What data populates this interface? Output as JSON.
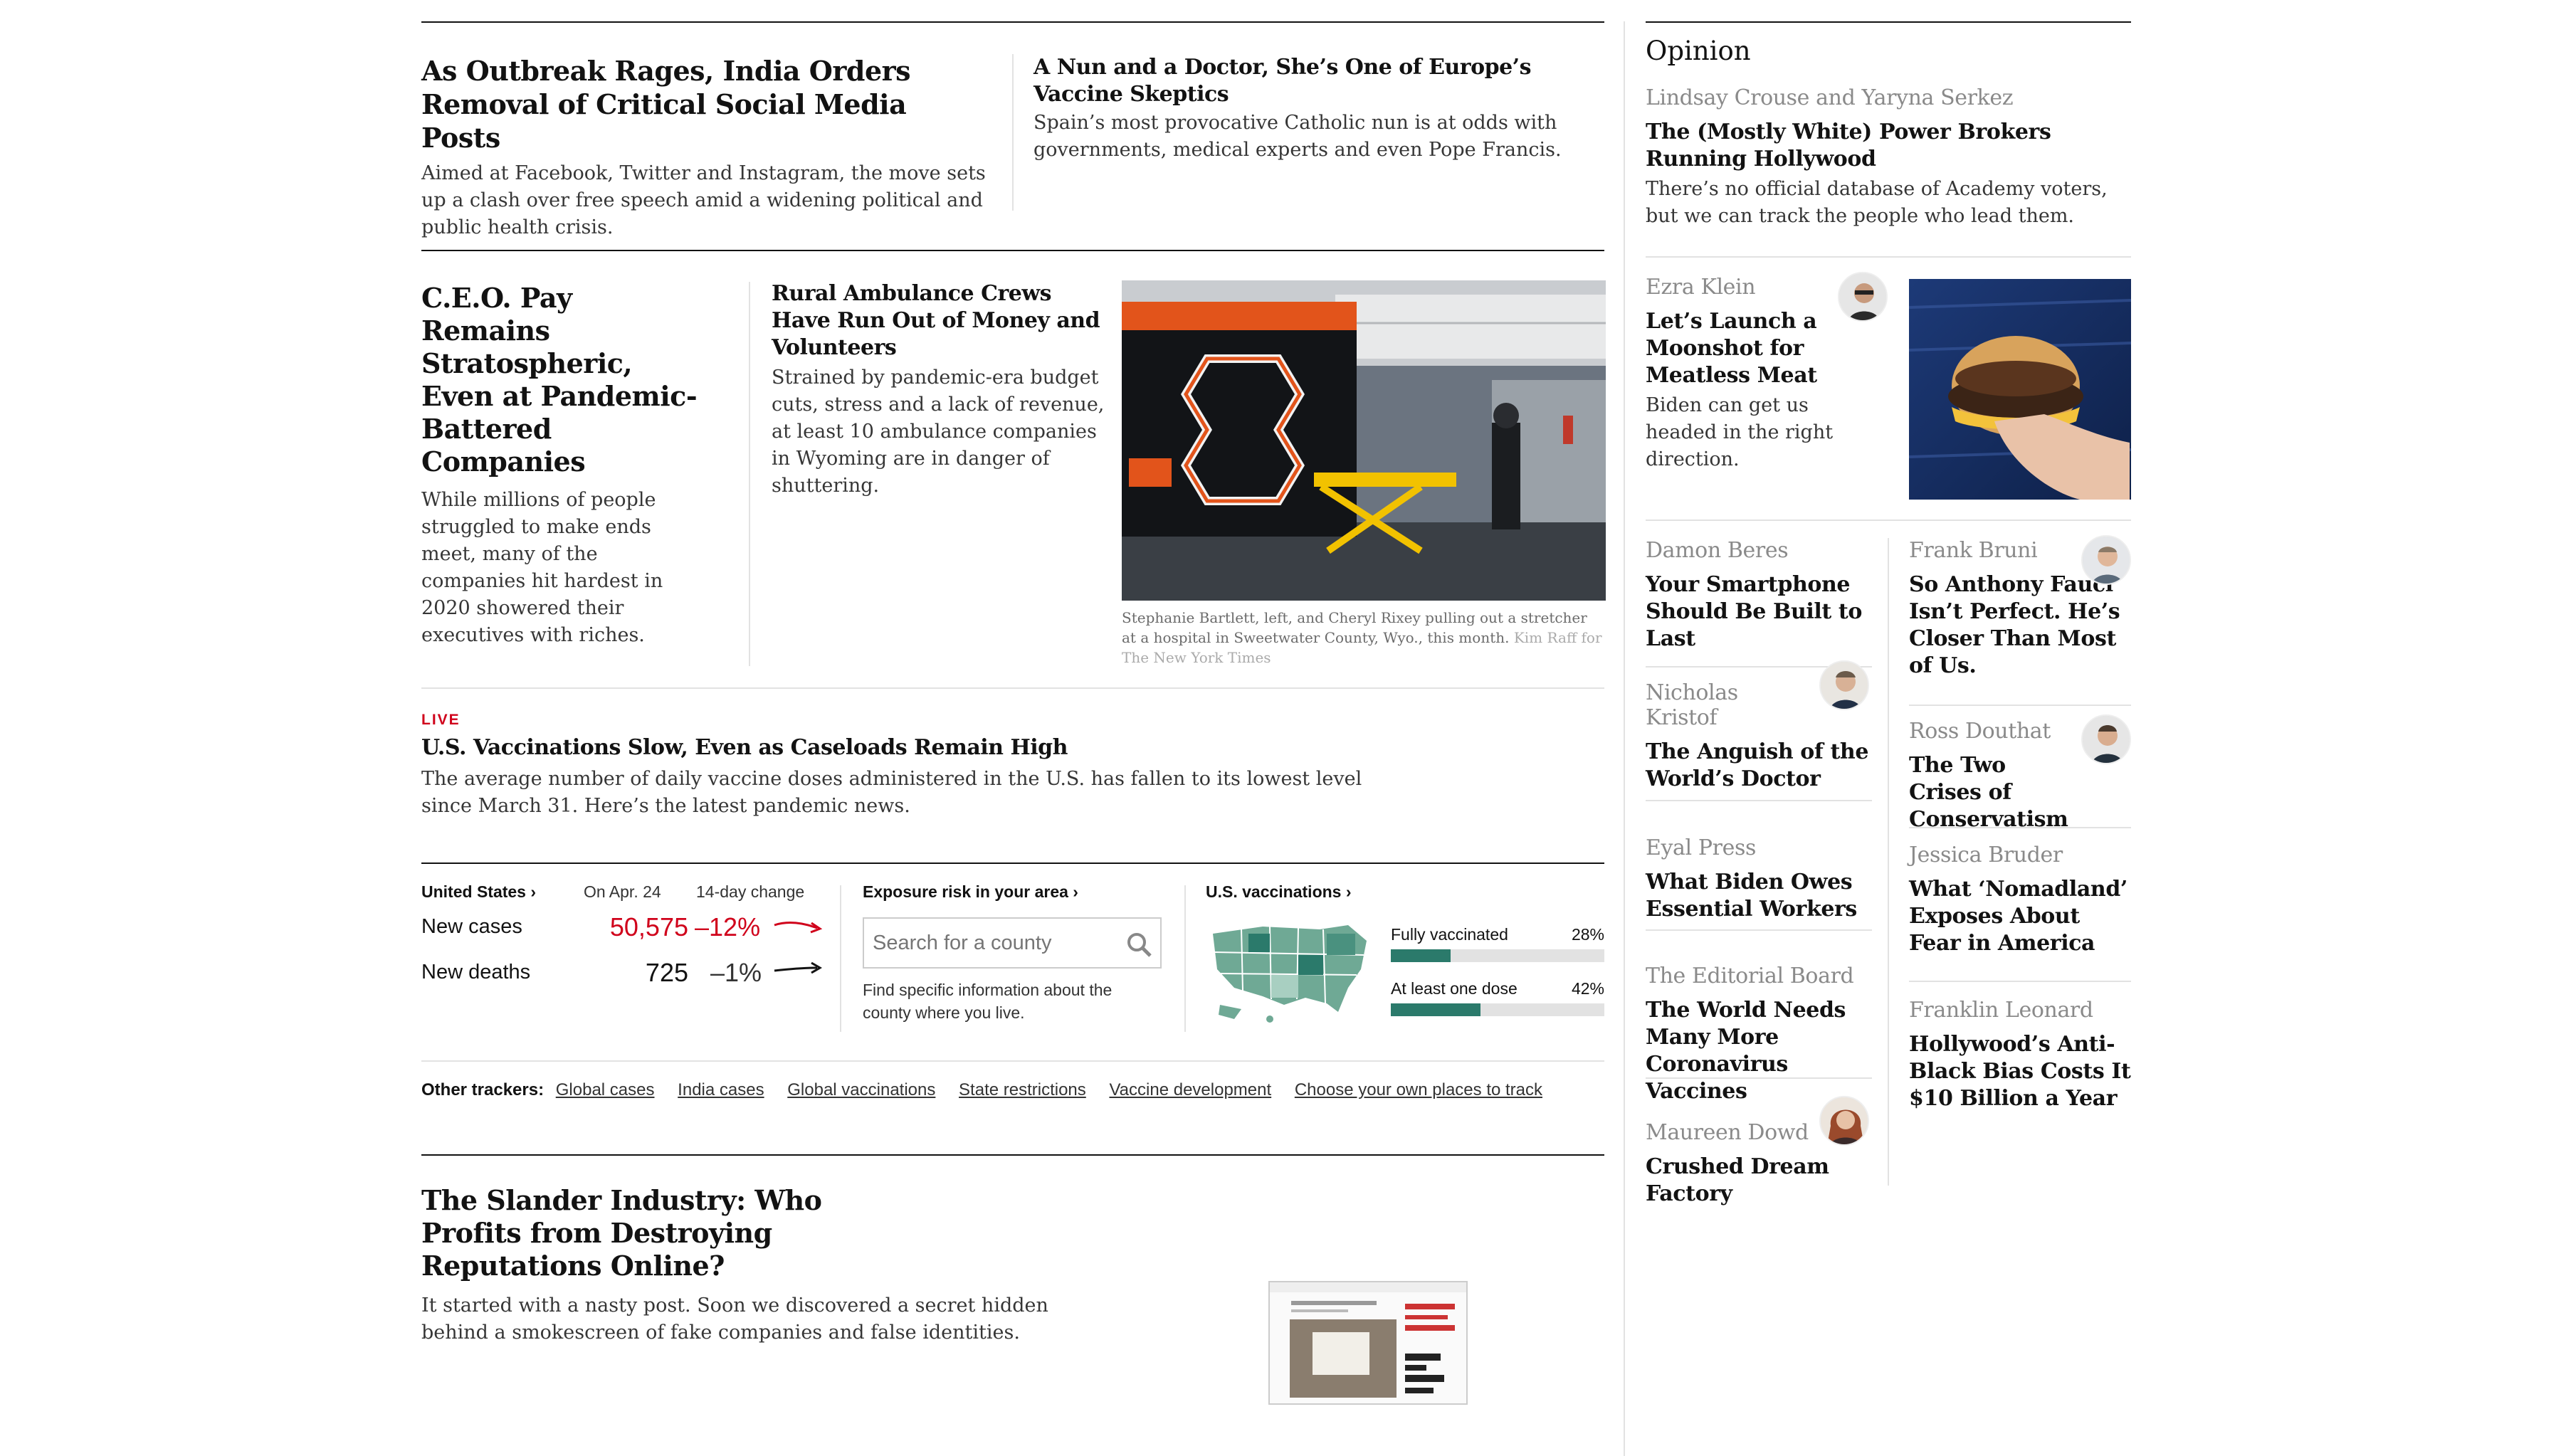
{
  "top": {
    "story1": {
      "headline": "As Outbreak Rages, India Orders Removal of Critical Social Media Posts",
      "summary": "Aimed at Facebook, Twitter and Instagram, the move sets up a clash over free speech amid a widening political and public health crisis."
    },
    "story2": {
      "headline": "A Nun and a Doctor, She’s One of Europe’s Vaccine Skeptics",
      "summary": "Spain’s most provocative Catholic nun is at odds with governments, medical experts and even Pope Francis."
    }
  },
  "mid": {
    "story3": {
      "headline": "C.E.O. Pay Remains Stratospheric, Even at Pandemic-Battered Companies",
      "summary": "While millions of people struggled to make ends meet, many of the companies hit hardest in 2020 showered their executives with riches."
    },
    "story4": {
      "headline": "Rural Ambulance Crews Have Run Out of Money and Volunteers",
      "summary": "Strained by pandemic-era budget cuts, stress and a lack of revenue, at least 10 ambulance companies in Wyoming are in danger of shuttering."
    },
    "photo": {
      "caption": "Stephanie Bartlett, left, and Cheryl Rixey pulling out a stretcher at a hospital in Sweetwater County, Wyo., this month.",
      "credit": "Kim Raff for The New York Times"
    }
  },
  "live": {
    "kicker": "LIVE",
    "headline": "U.S. Vaccinations Slow, Even as Caseloads Remain High",
    "summary": "The average number of daily vaccine doses administered in the U.S. has fallen to its lowest level since March 31. Here’s the latest pandemic news."
  },
  "tracker": {
    "us_label": "United States ›",
    "date_label": "On Apr. 24",
    "change_label": "14-day change",
    "cases_label": "New cases",
    "cases_value": "50,575",
    "cases_change": "–12%",
    "deaths_label": "New deaths",
    "deaths_value": "725",
    "deaths_change": "–1%",
    "exposure_label": "Exposure risk in your area ›",
    "search_placeholder": "Search for a county",
    "exposure_note": "Find specific information about the county where you live.",
    "vacc_label": "U.S. vaccinations ›",
    "fully_label": "Fully vaccinated",
    "fully_pct": "28%",
    "fully_value": 0.28,
    "one_label": "At least one dose",
    "one_pct": "42%",
    "one_value": 0.42,
    "accent_red": "#d0021b",
    "vacc_green": "#2b7a6b"
  },
  "other_trackers": {
    "label": "Other trackers:",
    "links": [
      "Global cases",
      "India cases",
      "Global vaccinations",
      "State restrictions",
      "Vaccine development",
      "Choose your own places to track"
    ]
  },
  "slander": {
    "headline": "The Slander Industry: Who Profits from Destroying Reputations Online?",
    "summary": "It started with a nasty post. Soon we discovered a secret hidden behind a smokescreen of fake companies and false identities."
  },
  "opinion": {
    "title": "Opinion",
    "lead": {
      "byline": "Lindsay Crouse and Yaryna Serkez",
      "headline": "The (Mostly White) Power Brokers Running Hollywood",
      "summary": "There’s no official database of Academy voters, but we can track the people who lead them."
    },
    "klein": {
      "byline": "Ezra Klein",
      "headline": "Let’s Launch a Moonshot for Meatless Meat",
      "summary": "Biden can get us headed in the right direction."
    },
    "left": [
      {
        "byline": "Damon Beres",
        "headline": "Your Smartphone Should Be Built to Last"
      },
      {
        "byline": "Nicholas Kristof",
        "headline": "The Anguish of the World’s Doctor"
      },
      {
        "byline": "Eyal Press",
        "headline": "What Biden Owes Essential Workers"
      },
      {
        "byline": "The Editorial Board",
        "headline": "The World Needs Many More Coronavirus Vaccines"
      },
      {
        "byline": "Maureen Dowd",
        "headline": "Crushed Dream Factory"
      }
    ],
    "right": [
      {
        "byline": "Frank Bruni",
        "headline": "So Anthony Fauci Isn’t Perfect. He’s Closer Than Most of Us."
      },
      {
        "byline": "Ross Douthat",
        "headline": "The Two Crises of Conservatism"
      },
      {
        "byline": "Jessica Bruder",
        "headline": "What ‘Nomadland’ Exposes About Fear in America"
      },
      {
        "byline": "Franklin Leonard",
        "headline": "Hollywood’s Anti-Black Bias Costs It $10 Billion a Year"
      }
    ]
  }
}
